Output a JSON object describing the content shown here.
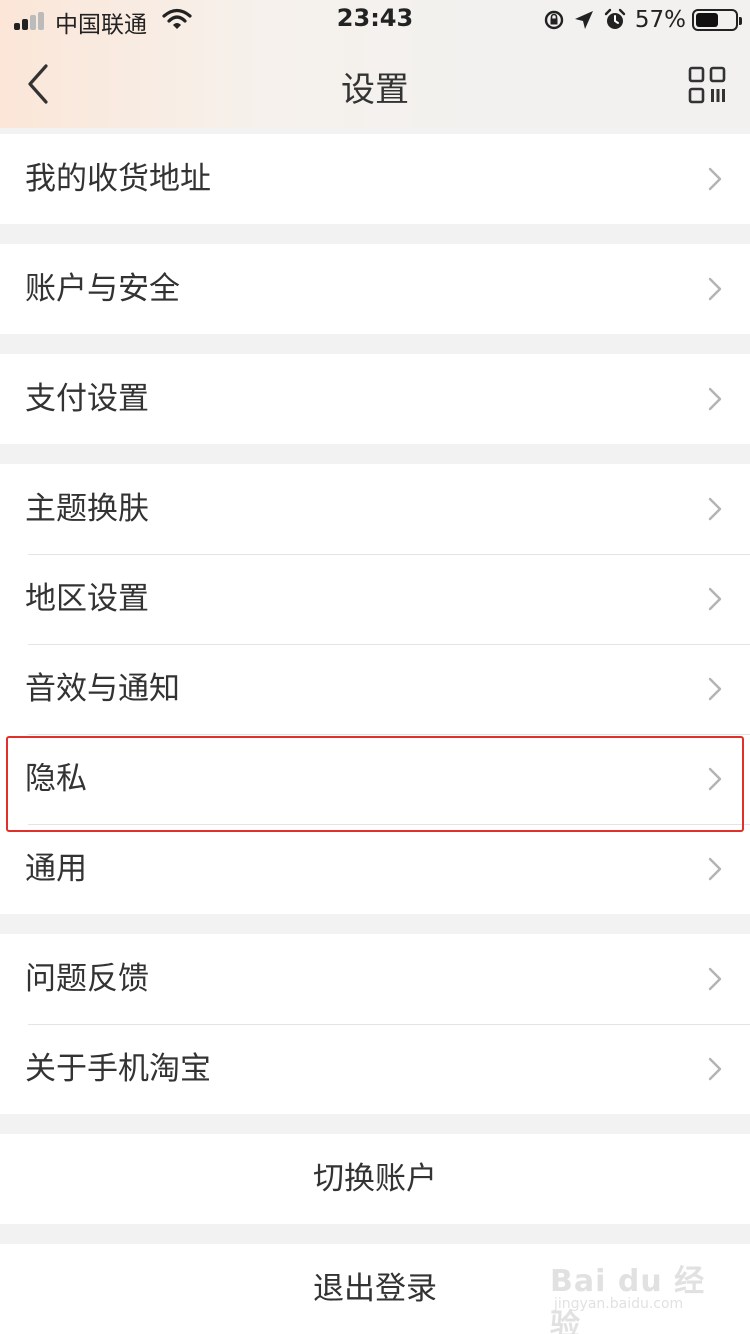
{
  "status_bar": {
    "carrier": "中国联通",
    "time": "23:43",
    "battery_percent": "57%",
    "battery_level": 0.57,
    "signal_bars": 2
  },
  "nav": {
    "title": "设置",
    "back_icon": "chevron-left-icon",
    "right_icon": "qr-code-icon"
  },
  "groups": [
    {
      "items": [
        {
          "label": "我的收货地址"
        }
      ]
    },
    {
      "items": [
        {
          "label": "账户与安全"
        }
      ]
    },
    {
      "items": [
        {
          "label": "支付设置"
        }
      ]
    },
    {
      "items": [
        {
          "label": "主题换肤"
        },
        {
          "label": "地区设置"
        },
        {
          "label": "音效与通知"
        },
        {
          "label": "隐私"
        },
        {
          "label": "通用"
        }
      ]
    },
    {
      "items": [
        {
          "label": "问题反馈"
        },
        {
          "label": "关于手机淘宝"
        }
      ]
    }
  ],
  "actions": {
    "switch_account": "切换账户",
    "logout": "退出登录"
  },
  "highlighted_item": "隐私",
  "watermark": {
    "text": "Bai du 经验",
    "sub": "jingyan.baidu.com"
  },
  "colors": {
    "highlight_border": "#e0302a",
    "background": "#f2f2f2"
  }
}
